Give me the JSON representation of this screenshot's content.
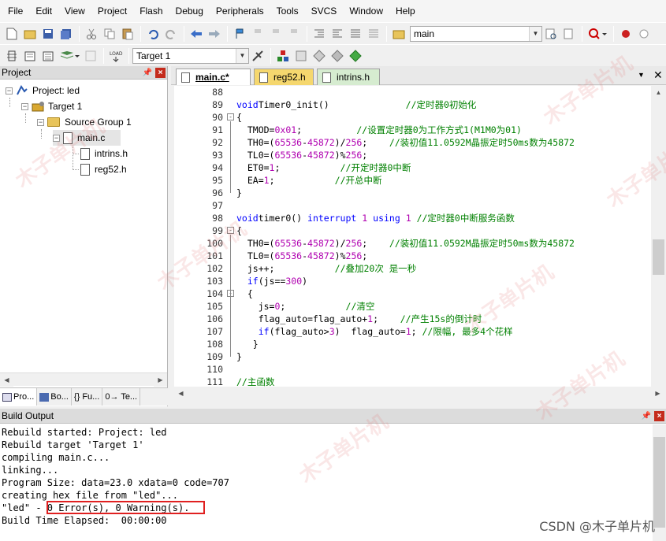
{
  "menu": [
    "File",
    "Edit",
    "View",
    "Project",
    "Flash",
    "Debug",
    "Peripherals",
    "Tools",
    "SVCS",
    "Window",
    "Help"
  ],
  "toolbar1": {
    "find_value": "main"
  },
  "toolbar2": {
    "target_value": "Target 1"
  },
  "project_panel": {
    "title": "Project",
    "tree": {
      "project": "Project: led",
      "target": "Target 1",
      "group": "Source Group 1",
      "files": [
        "main.c",
        "intrins.h",
        "reg52.h"
      ]
    },
    "tabs": [
      "Pro...",
      "Bo...",
      "{} Fu...",
      "0→ Te..."
    ]
  },
  "editor": {
    "tabs": [
      "main.c*",
      "reg52.h",
      "intrins.h"
    ],
    "lines": [
      {
        "n": "88",
        "parts": []
      },
      {
        "n": "89",
        "parts": [
          [
            "kw",
            "void"
          ],
          [
            "",
            "Timer0_init()"
          ],
          [
            "",
            "              "
          ],
          [
            "cm",
            "//定时器0初始化"
          ]
        ]
      },
      {
        "n": "90",
        "fold": "-",
        "parts": [
          [
            "",
            "{"
          ]
        ]
      },
      {
        "n": "91",
        "parts": [
          [
            "",
            "  TMOD="
          ],
          [
            "nm",
            "0x01"
          ],
          [
            "",
            ";"
          ],
          [
            "",
            "          "
          ],
          [
            "cm",
            "//设置定时器0为工作方式1(M1M0为01)"
          ]
        ]
      },
      {
        "n": "92",
        "parts": [
          [
            "",
            "  TH0=("
          ],
          [
            "nm",
            "65536"
          ],
          [
            "",
            "-"
          ],
          [
            "nm",
            "45872"
          ],
          [
            "",
            ")/"
          ],
          [
            "nm",
            "256"
          ],
          [
            "",
            ";    "
          ],
          [
            "cm",
            "//装初值11.0592M晶振定时50ms数为45872"
          ]
        ]
      },
      {
        "n": "93",
        "parts": [
          [
            "",
            "  TL0=("
          ],
          [
            "nm",
            "65536"
          ],
          [
            "",
            "-"
          ],
          [
            "nm",
            "45872"
          ],
          [
            "",
            ")%"
          ],
          [
            "nm",
            "256"
          ],
          [
            "",
            ";"
          ]
        ]
      },
      {
        "n": "94",
        "parts": [
          [
            "",
            "  ET0="
          ],
          [
            "nm",
            "1"
          ],
          [
            "",
            ";"
          ],
          [
            "",
            "           "
          ],
          [
            "cm",
            "//开定时器0中断"
          ]
        ]
      },
      {
        "n": "95",
        "parts": [
          [
            "",
            "  EA="
          ],
          [
            "nm",
            "1"
          ],
          [
            "",
            ";"
          ],
          [
            "",
            "           "
          ],
          [
            "cm",
            "//开总中断"
          ]
        ]
      },
      {
        "n": "96",
        "parts": [
          [
            "",
            "}"
          ]
        ]
      },
      {
        "n": "97",
        "parts": []
      },
      {
        "n": "98",
        "parts": [
          [
            "kw",
            "void"
          ],
          [
            "",
            "timer0() "
          ],
          [
            "kw",
            "interrupt"
          ],
          [
            "",
            " "
          ],
          [
            "nm",
            "1"
          ],
          [
            "",
            " "
          ],
          [
            "kw",
            "using"
          ],
          [
            "",
            " "
          ],
          [
            "nm",
            "1"
          ],
          [
            "",
            " "
          ],
          [
            "cm",
            "//定时器0中断服务函数"
          ]
        ]
      },
      {
        "n": "99",
        "fold": "-",
        "parts": [
          [
            "",
            "{"
          ]
        ]
      },
      {
        "n": "100",
        "parts": [
          [
            "",
            "  TH0=("
          ],
          [
            "nm",
            "65536"
          ],
          [
            "",
            "-"
          ],
          [
            "nm",
            "45872"
          ],
          [
            "",
            ")/"
          ],
          [
            "nm",
            "256"
          ],
          [
            "",
            ";    "
          ],
          [
            "cm",
            "//装初值11.0592M晶振定时50ms数为45872"
          ]
        ]
      },
      {
        "n": "101",
        "parts": [
          [
            "",
            "  TL0=("
          ],
          [
            "nm",
            "65536"
          ],
          [
            "",
            "-"
          ],
          [
            "nm",
            "45872"
          ],
          [
            "",
            ")%"
          ],
          [
            "nm",
            "256"
          ],
          [
            "",
            ";"
          ]
        ]
      },
      {
        "n": "102",
        "parts": [
          [
            "",
            "  js++;"
          ],
          [
            "",
            "           "
          ],
          [
            "cm",
            "//叠加20次 是一秒"
          ]
        ]
      },
      {
        "n": "103",
        "parts": [
          [
            "",
            "  "
          ],
          [
            "kw",
            "if"
          ],
          [
            "",
            "(js=="
          ],
          [
            "nm",
            "300"
          ],
          [
            "",
            ")"
          ]
        ]
      },
      {
        "n": "104",
        "fold": "-",
        "parts": [
          [
            "",
            "  {"
          ]
        ]
      },
      {
        "n": "105",
        "parts": [
          [
            "",
            "    js="
          ],
          [
            "nm",
            "0"
          ],
          [
            "",
            ";"
          ],
          [
            "",
            "           "
          ],
          [
            "cm",
            "//清空"
          ]
        ]
      },
      {
        "n": "106",
        "parts": [
          [
            "",
            "    flag_auto=flag_auto+"
          ],
          [
            "nm",
            "1"
          ],
          [
            "",
            ";    "
          ],
          [
            "cm",
            "//产生15s的倒计时"
          ]
        ]
      },
      {
        "n": "107",
        "parts": [
          [
            "",
            "    "
          ],
          [
            "kw",
            "if"
          ],
          [
            "",
            "(flag_auto>"
          ],
          [
            "nm",
            "3"
          ],
          [
            "",
            ")  flag_auto="
          ],
          [
            "nm",
            "1"
          ],
          [
            "",
            "; "
          ],
          [
            "cm",
            "//限幅, 最多4个花样"
          ]
        ]
      },
      {
        "n": "108",
        "parts": [
          [
            "",
            "   }"
          ]
        ]
      },
      {
        "n": "109",
        "parts": [
          [
            "",
            "}"
          ]
        ]
      },
      {
        "n": "110",
        "parts": []
      },
      {
        "n": "111",
        "parts": [
          [
            "cm",
            "//主函数"
          ]
        ]
      }
    ]
  },
  "build_output": {
    "title": "Build Output",
    "lines": [
      "Rebuild started: Project: led",
      "Rebuild target 'Target 1'",
      "compiling main.c...",
      "linking...",
      "Program Size: data=23.0 xdata=0 code=707",
      "creating hex file from \"led\"...",
      "\"led\" - 0 Error(s), 0 Warning(s).",
      "Build Time Elapsed:  00:00:00"
    ]
  },
  "watermark": "CSDN @木子单片机",
  "watermark_bg": "木子单片机",
  "colors": {
    "keyword": "#0000ff",
    "comment": "#008000",
    "number": "#b000b0",
    "highlight_box": "#e02020"
  }
}
